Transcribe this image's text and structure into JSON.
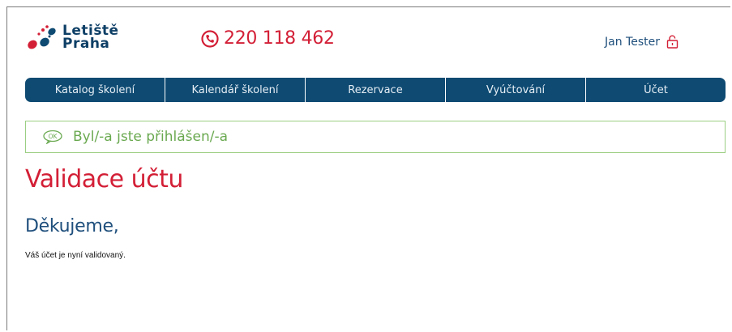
{
  "header": {
    "logo_line1": "Letiště",
    "logo_line2": "Praha",
    "phone": "220 118 462",
    "user_name": "Jan Tester",
    "icons": {
      "phone": "phone-icon",
      "lock": "unlock-icon",
      "logo": "airport-logo-icon"
    }
  },
  "nav": {
    "items": [
      {
        "label": "Katalog školení"
      },
      {
        "label": "Kalendář školení"
      },
      {
        "label": "Rezervace"
      },
      {
        "label": "Vyúčtování"
      },
      {
        "label": "Účet"
      }
    ]
  },
  "alert": {
    "icon_text": "OK",
    "message": "Byl/-a jste přihlášen/-a"
  },
  "main": {
    "title": "Validace účtu",
    "subtitle": "Děkujeme,",
    "text": "Váš účet je nyní validovaný."
  },
  "colors": {
    "brand_red": "#d31f36",
    "brand_blue": "#0e4a72",
    "success_green": "#6aa950"
  }
}
